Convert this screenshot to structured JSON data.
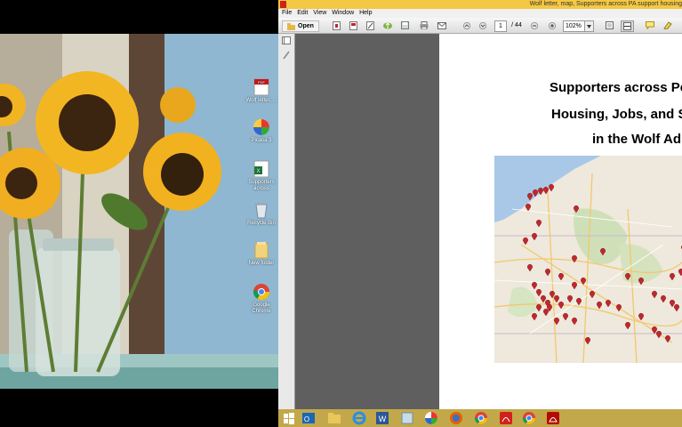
{
  "window": {
    "title": "Wolf letter, map, Supporters across PA support housing",
    "menu": [
      "File",
      "Edit",
      "View",
      "Window",
      "Help"
    ],
    "toolbar": {
      "open_label": "Open",
      "page_current": "1",
      "page_total": "/ 44",
      "zoom": "102%"
    }
  },
  "document": {
    "title_lines": [
      "Supporters across Penn",
      "Housing, Jobs, and Ser",
      "in the Wolf Adm"
    ]
  },
  "colors": {
    "titlebar": "#f4c842",
    "taskbar": "#c2a84a",
    "marker": "#c0282d"
  },
  "desktop_icons": [
    {
      "name": "pdf-file-icon",
      "label": "Wolf letter, ..."
    },
    {
      "name": "picasa-icon",
      "label": "Picasa 3"
    },
    {
      "name": "excel-file-icon",
      "label": "Supporters across"
    },
    {
      "name": "recycle-bin-icon",
      "label": "Recycle Bin"
    },
    {
      "name": "folder-icon",
      "label": "New folder"
    },
    {
      "name": "chrome-icon",
      "label": "Google Chrome"
    }
  ],
  "taskbar_apps": [
    "windows-start-icon",
    "outlook-icon",
    "file-explorer-icon",
    "internet-explorer-icon",
    "word-icon",
    "snipping-icon",
    "picasa-icon",
    "firefox-icon",
    "chrome-icon",
    "acrobat-icon",
    "chrome-icon",
    "adobe-reader-icon"
  ]
}
